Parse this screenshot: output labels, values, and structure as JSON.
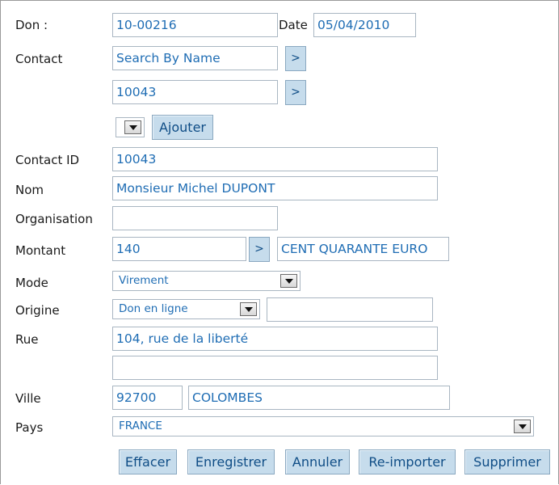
{
  "labels": {
    "don": "Don :",
    "date": "Date",
    "contact": "Contact",
    "contact_id": "Contact ID",
    "nom": "Nom",
    "organisation": "Organisation",
    "montant": "Montant",
    "mode": "Mode",
    "origine": "Origine",
    "rue": "Rue",
    "ville": "Ville",
    "pays": "Pays"
  },
  "fields": {
    "don_number": "10-00216",
    "date": "05/04/2010",
    "contact_search": "Search By Name",
    "contact_code": "10043",
    "contact_id": "10043",
    "nom": "Monsieur Michel DUPONT",
    "organisation": "",
    "montant": "140",
    "montant_words": "CENT QUARANTE EURO",
    "mode": "Virement",
    "origine": "Don en ligne",
    "origine_detail": "",
    "rue1": "104, rue de la liberté",
    "rue2": "",
    "code_postal": "92700",
    "ville": "COLOMBES",
    "pays": "FRANCE"
  },
  "buttons": {
    "go": ">",
    "ajouter": "Ajouter",
    "effacer": "Effacer",
    "enregistrer": "Enregistrer",
    "annuler": "Annuler",
    "reimporter": "Re-importer",
    "supprimer": "Supprimer"
  },
  "colors": {
    "field_text": "#1f6db4",
    "button_bg": "#c6dcec",
    "button_text": "#0f4d86"
  }
}
